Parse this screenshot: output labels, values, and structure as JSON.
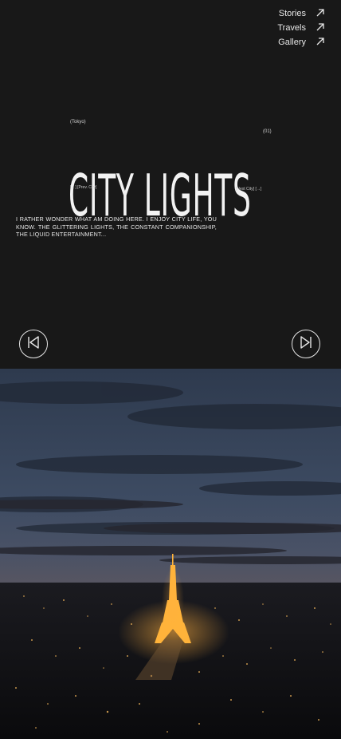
{
  "nav": {
    "items": [
      {
        "label": "Stories",
        "icon": "arrow-up-right-icon"
      },
      {
        "label": "Travels",
        "icon": "arrow-up-right-icon"
      },
      {
        "label": "Gallery",
        "icon": "arrow-up-right-icon"
      }
    ]
  },
  "hero": {
    "city": "(Tokyo)",
    "title": "CITY LIGHTS",
    "count": "(01)",
    "prev": "[←] [Prev. City]",
    "next": "[Next City] [→]"
  },
  "blurb": "I RATHER WONDER WHAT AM DOING HERE. I ENJOY CITY LIFE, YOU KNOW. THE GLITTERING LIGHTS, THE CONSTANT COMPANIONSHIP, THE LIQUID ENTERTAINMENT...",
  "controls": {
    "prev_icon": "skip-back-icon",
    "next_icon": "skip-forward-icon"
  },
  "photo": {
    "subject": "Eiffel Tower at dusk"
  }
}
